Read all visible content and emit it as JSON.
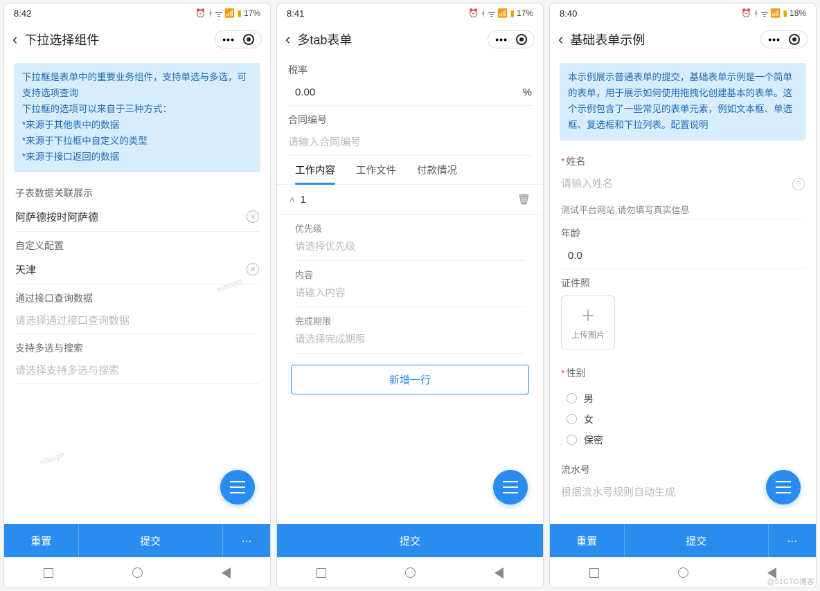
{
  "credit": "@51CTO博客",
  "watermark": "xiaoqin",
  "screens": {
    "a": {
      "time": "8:42",
      "battery": "17%",
      "title": "下拉选择组件",
      "tip_lines": [
        "下拉框是表单中的重要业务组件，支持单选与多选，可支持选项查询",
        "下拉框的选项可以来自于三种方式：",
        "*来源于其他表中的数据",
        "*来源于下拉框中自定义的类型",
        "*来源于接口返回的数据"
      ],
      "f1_label": "子表数据关联展示",
      "f1_value": "阿萨德按时阿萨德",
      "f2_label": "自定义配置",
      "f2_value": "天津",
      "f3_label": "通过接口查询数据",
      "f3_ph": "请选择通过接口查询数据",
      "f4_label": "支持多选与搜索",
      "f4_ph": "请选择支持多选与搜索",
      "btn_reset": "重置",
      "btn_submit": "提交",
      "btn_more": "···"
    },
    "b": {
      "time": "8:41",
      "battery": "17%",
      "title": "多tab表单",
      "rate_label": "税率",
      "rate_value": "0.00",
      "rate_suffix": "%",
      "contract_label": "合同编号",
      "contract_ph": "请输入合同编号",
      "tabs": [
        "工作内容",
        "工作文件",
        "付款情况"
      ],
      "collapse_num": "1",
      "p_label": "优先级",
      "p_ph": "请选择优先级",
      "c_label": "内容",
      "c_ph": "请输入内容",
      "d_label": "完成期限",
      "d_ph": "请选择完成期限",
      "add_line": "新增一行",
      "btn_submit": "提交"
    },
    "c": {
      "time": "8:40",
      "battery": "18%",
      "title": "基础表单示例",
      "tip": "本示例展示普通表单的提交，基础表单示例是一个简单的表单，用于展示如何使用拖拽化创建基本的表单。这个示例包含了一些常见的表单元素，例如文本框、单选框、复选框和下拉列表。配置说明",
      "name_label": "姓名",
      "name_ph": "请输入姓名",
      "name_hint": "测试平台网站,请勿填写真实信息",
      "age_label": "年龄",
      "age_value": "0.0",
      "photo_label": "证件照",
      "upload_label": "上传图片",
      "gender_label": "性别",
      "gender_options": [
        "男",
        "女",
        "保密"
      ],
      "serial_label": "流水号",
      "serial_ph": "根据流水号规则自动生成",
      "btn_reset": "重置",
      "btn_submit": "提交",
      "btn_more": "···"
    }
  }
}
